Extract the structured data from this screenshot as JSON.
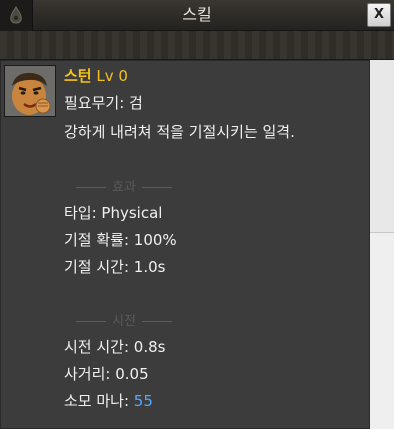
{
  "window": {
    "title": "스킬",
    "close_label": "X",
    "colors": {
      "skill_name": "#f3c21b",
      "mana_value": "#54a9ff",
      "background": "#3c3c3c"
    }
  },
  "tooltip": {
    "icon": "stun-skill-portrait",
    "name": "스턴",
    "level": "Lv 0",
    "weapon_req": "필요무기: 검",
    "description": "강하게 내려쳐 적을 기절시키는 일격.",
    "effect_section": "효과",
    "type": "타입: Physical",
    "stun_chance": "기절 확률: 100%",
    "stun_duration": "기절 시간: 1.0s",
    "cast_section": "시전",
    "cast_time": "시전 시간: 0.8s",
    "range": "사거리: 0.05",
    "mana_label": "소모 마나: ",
    "mana_value": "55"
  }
}
